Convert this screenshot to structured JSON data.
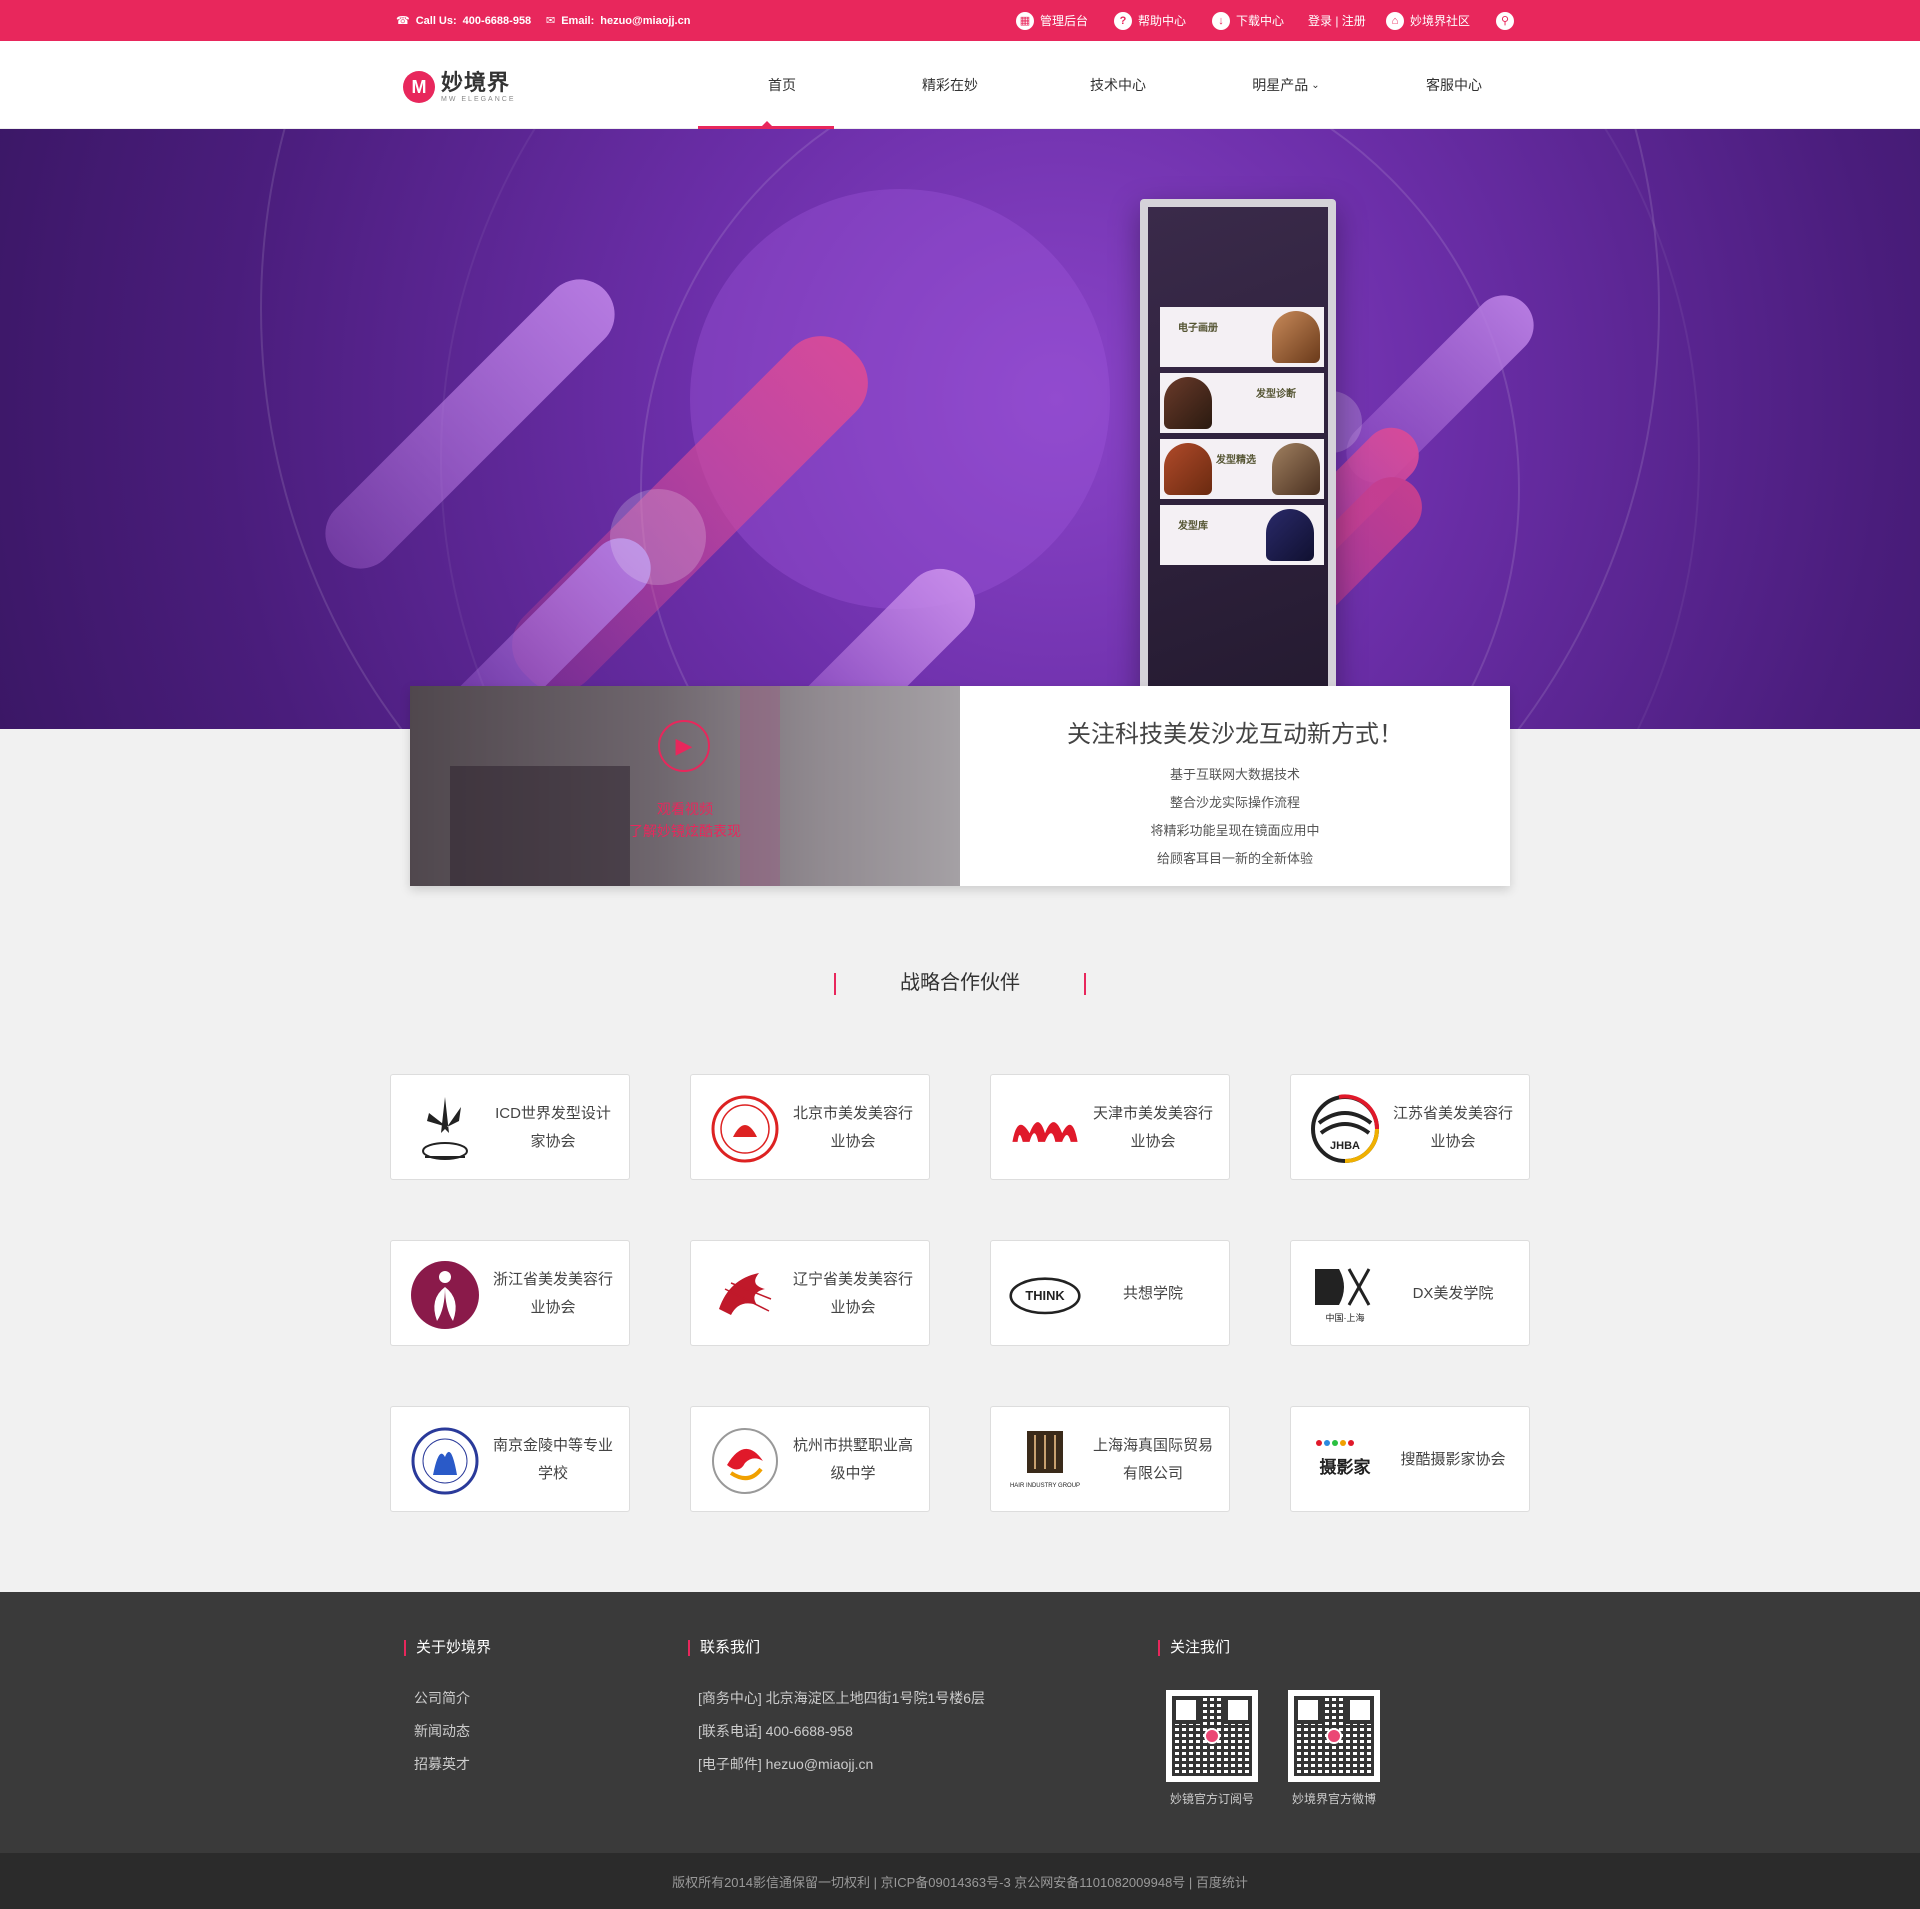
{
  "topbar": {
    "call_label": "Call Us:",
    "call_value": "400-6688-958",
    "email_label": "Email:",
    "email_value": "hezuo@miaojj.cn",
    "admin": "管理后台",
    "help": "帮助中心",
    "download": "下载中心",
    "login": "登录 | 注册",
    "community": "妙境界社区"
  },
  "logo": {
    "cn": "妙境界",
    "en": "MW ELEGANCE"
  },
  "nav": [
    {
      "label": "首页"
    },
    {
      "label": "精彩在妙"
    },
    {
      "label": "技术中心"
    },
    {
      "label": "明星产品"
    },
    {
      "label": "客服中心"
    }
  ],
  "kiosk": {
    "panels": [
      "电子画册",
      "发型诊断",
      "发型精选",
      "发型库"
    ]
  },
  "video": {
    "caption_line1": "观看视频",
    "caption_line2": "了解妙镜炫酷表现",
    "title": "关注科技美发沙龙互动新方式！",
    "lines": [
      "基于互联网大数据技术",
      "整合沙龙实际操作流程",
      "将精彩功能呈现在镜面应用中",
      "给顾客耳目一新的全新体验"
    ]
  },
  "partners_title": "战略合作伙伴",
  "partners": [
    {
      "name": "ICD世界发型设计家协会"
    },
    {
      "name": "北京市美发美容行业协会"
    },
    {
      "name": "天津市美发美容行业协会"
    },
    {
      "name": "江苏省美发美容行业协会",
      "logo_text": "JHBA"
    },
    {
      "name": "浙江省美发美容行业协会"
    },
    {
      "name": "辽宁省美发美容行业协会"
    },
    {
      "name": "共想学院",
      "logo_text": "THINK"
    },
    {
      "name": "DX美发学院",
      "logo_text": "中国·上海"
    },
    {
      "name": "南京金陵中等专业学校"
    },
    {
      "name": "杭州市拱墅职业高级中学"
    },
    {
      "name": "上海海真国际贸易有限公司",
      "logo_text": "HAIR INDUSTRY GROUP"
    },
    {
      "name": "搜酷摄影家协会",
      "logo_text": "摄影家"
    }
  ],
  "footer": {
    "about_title": "关于妙境界",
    "about_links": [
      "公司简介",
      "新闻动态",
      "招募英才"
    ],
    "contact_title": "联系我们",
    "contact_lines": [
      "[商务中心] 北京海淀区上地四街1号院1号楼6层",
      "[联系电话] 400-6688-958",
      "[电子邮件] hezuo@miaojj.cn"
    ],
    "follow_title": "关注我们",
    "qr1_label": "妙镜官方订阅号",
    "qr2_label": "妙境界官方微博"
  },
  "copyright": "版权所有2014影信通保留一切权利 | 京ICP备09014363号-3 京公网安备1101082009948号 | 百度统计",
  "colors": {
    "accent": "#e8275c",
    "hero": "#6b2ea8",
    "footer": "#3a3a3a"
  }
}
